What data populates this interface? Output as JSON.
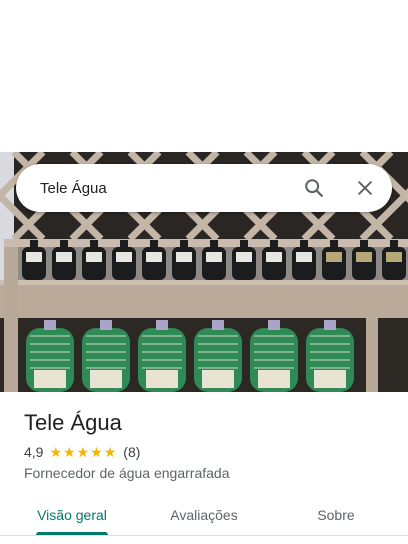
{
  "search": {
    "query": "Tele Água",
    "search_icon": "search-icon",
    "close_icon": "close-icon"
  },
  "hero": {
    "description_icon": "photo"
  },
  "place": {
    "name": "Tele Água",
    "rating": "4,9",
    "stars": 5,
    "review_count": "(8)",
    "category": "Fornecedor de água engarrafada"
  },
  "tabs": [
    {
      "label": "Visão geral",
      "active": true
    },
    {
      "label": "Avaliações",
      "active": false
    },
    {
      "label": "Sobre",
      "active": false
    }
  ],
  "colors": {
    "accent": "#00796b",
    "star": "#f4b400"
  }
}
